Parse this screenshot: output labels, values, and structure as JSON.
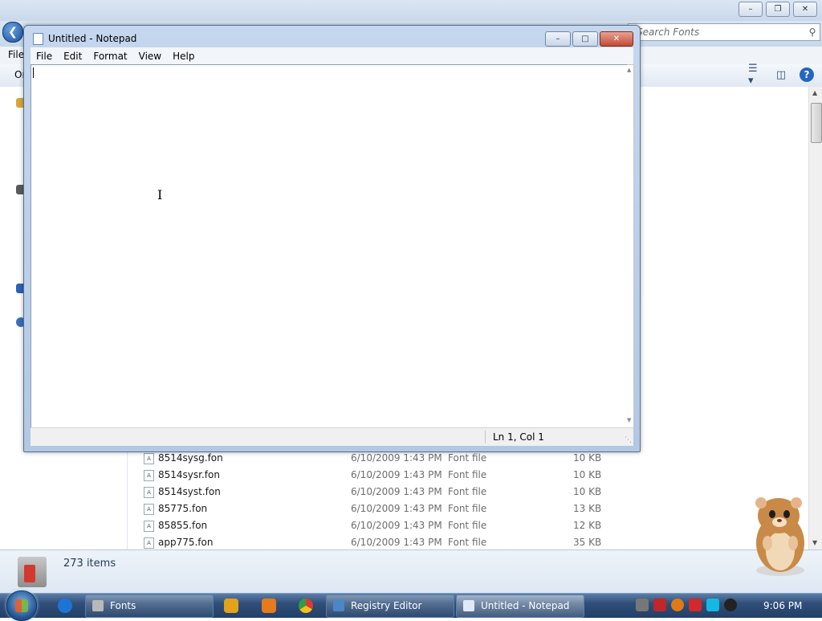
{
  "explorer": {
    "search_placeholder": "Search Fonts",
    "menu_file": "File",
    "organize_label": "Organize",
    "status_count": "273 items",
    "files": [
      {
        "name": "8514sysg.fon",
        "date": "6/10/2009 1:43 PM",
        "type": "Font file",
        "size": "10 KB"
      },
      {
        "name": "8514sysr.fon",
        "date": "6/10/2009 1:43 PM",
        "type": "Font file",
        "size": "10 KB"
      },
      {
        "name": "8514syst.fon",
        "date": "6/10/2009 1:43 PM",
        "type": "Font file",
        "size": "10 KB"
      },
      {
        "name": "85775.fon",
        "date": "6/10/2009 1:43 PM",
        "type": "Font file",
        "size": "13 KB"
      },
      {
        "name": "85855.fon",
        "date": "6/10/2009 1:43 PM",
        "type": "Font file",
        "size": "12 KB"
      },
      {
        "name": "app775.fon",
        "date": "6/10/2009 1:43 PM",
        "type": "Font file",
        "size": "35 KB"
      }
    ]
  },
  "notepad": {
    "title": "Untitled - Notepad",
    "menus": [
      "File",
      "Edit",
      "Format",
      "View",
      "Help"
    ],
    "content": "",
    "status_position": "Ln 1, Col 1"
  },
  "taskbar": {
    "tasks": [
      {
        "label": "Fonts",
        "active": false
      },
      {
        "label": "Registry Editor",
        "active": false
      },
      {
        "label": "Untitled - Notepad",
        "active": true
      }
    ],
    "clock": "9:06 PM"
  },
  "colors": {
    "taskbar": "#2f4f79",
    "notepad_frame": "#b2c8e3",
    "close_button": "#c24a33"
  }
}
